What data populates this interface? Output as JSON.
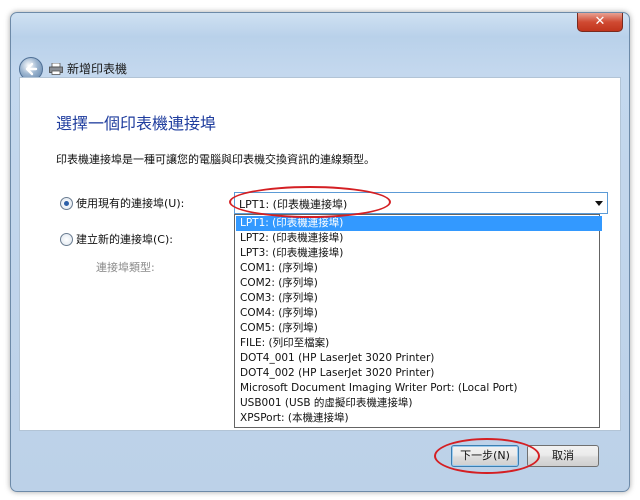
{
  "window": {
    "close_glyph": "✕"
  },
  "nav": {
    "title": "新增印表機"
  },
  "main": {
    "heading": "選擇一個印表機連接埠",
    "description": "印表機連接埠是一種可讓您的電腦與印表機交換資訊的連線類型。",
    "option_existing_label": "使用現有的連接埠(U):",
    "option_new_label": "建立新的連接埠(C):",
    "port_type_label": "連接埠類型:",
    "selected_port": "LPT1: (印表機連接埠)",
    "ports": [
      "LPT1: (印表機連接埠)",
      "LPT2: (印表機連接埠)",
      "LPT3: (印表機連接埠)",
      "COM1: (序列埠)",
      "COM2: (序列埠)",
      "COM3: (序列埠)",
      "COM4: (序列埠)",
      "COM5: (序列埠)",
      "FILE: (列印至檔案)",
      "DOT4_001 (HP LaserJet 3020 Printer)",
      "DOT4_002 (HP LaserJet 3020 Printer)",
      "Microsoft Document Imaging Writer Port: (Local Port)",
      "USB001 (USB 的虛擬印表機連接埠)",
      "XPSPort: (本機連接埠)"
    ]
  },
  "footer": {
    "next_label": "下一步(N)",
    "cancel_label": "取消"
  },
  "colors": {
    "heading": "#1f3d9e",
    "highlight": "#3399ff",
    "annotation": "#d41f23"
  },
  "icons": {
    "back": "back-arrow-icon",
    "printer": "printer-icon",
    "close": "close-icon",
    "dropdown": "chevron-down-icon"
  }
}
